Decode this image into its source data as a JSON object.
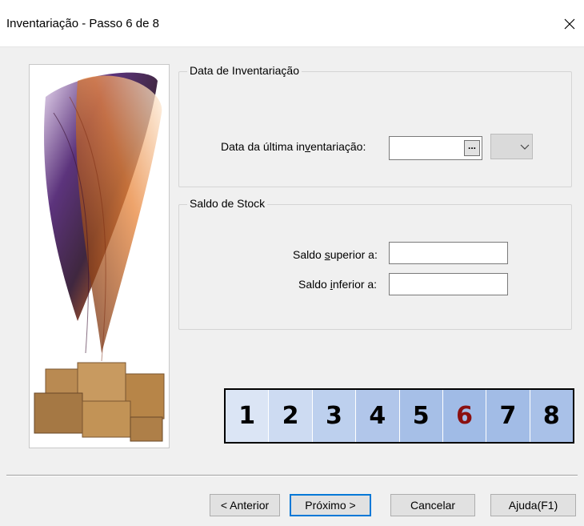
{
  "window": {
    "title": "Inventariação - Passo 6 de 8"
  },
  "inventory_group": {
    "legend": "Data de Inventariação",
    "last_inventory_label_pre": "Data da última in",
    "last_inventory_label_key": "v",
    "last_inventory_label_post": "entariação:",
    "last_inventory_value": "",
    "browse_label": "..."
  },
  "stock_group": {
    "legend": "Saldo de Stock",
    "upper_label_pre": "Saldo ",
    "upper_label_key": "s",
    "upper_label_post": "uperior a:",
    "upper_value": "",
    "lower_label_pre": "Saldo ",
    "lower_label_key": "i",
    "lower_label_post": "nferior a:",
    "lower_value": ""
  },
  "steps": {
    "current": 6,
    "items": [
      {
        "label": "1",
        "bg": "#dbe5f5",
        "color": "#000000"
      },
      {
        "label": "2",
        "bg": "#cddbf2",
        "color": "#000000"
      },
      {
        "label": "3",
        "bg": "#bdd0ee",
        "color": "#000000"
      },
      {
        "label": "4",
        "bg": "#b1c6ea",
        "color": "#000000"
      },
      {
        "label": "5",
        "bg": "#a6bfe7",
        "color": "#000000"
      },
      {
        "label": "6",
        "bg": "#a0bbe6",
        "color": "#8b1010"
      },
      {
        "label": "7",
        "bg": "#a2bce6",
        "color": "#000000"
      },
      {
        "label": "8",
        "bg": "#a9c1e8",
        "color": "#000000"
      }
    ]
  },
  "buttons": {
    "previous": "< Anterior",
    "next": "Próximo >",
    "cancel": "Cancelar",
    "help": "Ajuda(F1)"
  },
  "icons": {
    "close": "close-icon",
    "dropdown": "chevron-down-icon"
  }
}
